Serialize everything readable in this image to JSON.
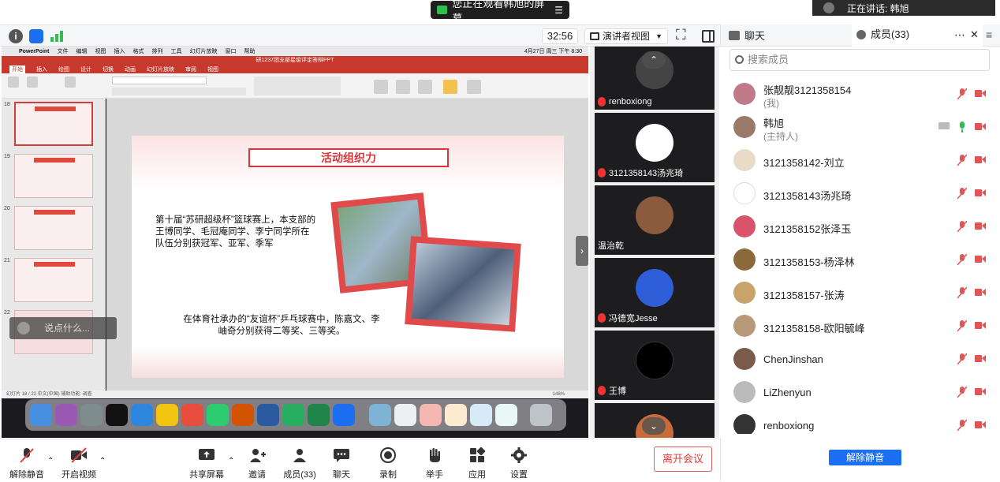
{
  "banner": {
    "watching": "您正在观看韩旭的屏幕",
    "menu_icon": "list-icon",
    "speaking": "正在讲话: 韩旭"
  },
  "toolbar": {
    "timer": "32:56",
    "view_mode": "演讲者视图",
    "view_caret": "▼",
    "fullscreen_glyph": "⛶"
  },
  "panel": {
    "chat_tab": "聊天",
    "members_tab": "成员(33)",
    "more": "⋯",
    "close": "✕",
    "menu": "≡",
    "search_placeholder": "搜索成员",
    "unmute_all": "解除静音"
  },
  "members": [
    {
      "name": "张靓靓3121358154",
      "role": "(我)",
      "avatar_color": "#c07a8a"
    },
    {
      "name": "韩旭",
      "role": "(主持人)",
      "avatar_color": "#9a7a6a",
      "mic_on": true
    },
    {
      "name": "3121358142-刘立",
      "role": "",
      "avatar_color": "#e8dcc8"
    },
    {
      "name": "3121358143汤兆琦",
      "role": "",
      "avatar_color": "#222222"
    },
    {
      "name": "3121358152张泽玉",
      "role": "",
      "avatar_color": "#d9536b"
    },
    {
      "name": "3121358153-杨泽林",
      "role": "",
      "avatar_color": "#8a6a3a"
    },
    {
      "name": "3121358157-张涛",
      "role": "",
      "avatar_color": "#c9a46a"
    },
    {
      "name": "3121358158-欧阳毓峰",
      "role": "",
      "avatar_color": "#b89a7a"
    },
    {
      "name": "ChenJinshan",
      "role": "",
      "avatar_color": "#7a5a4a"
    },
    {
      "name": "LiZhenyun",
      "role": "",
      "avatar_color": "#bbbbbb"
    },
    {
      "name": "renboxiong",
      "role": "",
      "avatar_color": "#333333"
    }
  ],
  "video_tiles": [
    {
      "name": "renboxiong",
      "avatar_color": "#444444"
    },
    {
      "name": "3121358143汤兆琦",
      "avatar_color": "#ffffff"
    },
    {
      "name": "温治乾",
      "avatar_color": "#8c5a3c"
    },
    {
      "name": "冯德宽Jesse",
      "avatar_color": "#2f5fd8"
    },
    {
      "name": "王博",
      "avatar_color": "#000000"
    },
    {
      "name": "",
      "avatar_color": "#c86a3a"
    }
  ],
  "scroll": {
    "up": "⌃",
    "down": "⌄",
    "collapse": "›"
  },
  "shared_screen": {
    "mac_menu": [
      "PowerPoint",
      "文件",
      "编辑",
      "视图",
      "插入",
      "格式",
      "排列",
      "工具",
      "幻灯片放映",
      "窗口",
      "帮助"
    ],
    "mac_clock": "4月27日 周三 下午 8:30",
    "doc_title": "研1237团支部星级评定答辩PPT",
    "ribbon_tabs": [
      "开始",
      "插入",
      "绘图",
      "设计",
      "切换",
      "动画",
      "幻灯片放映",
      "审阅",
      "视图"
    ],
    "slide_numbers": [
      "18",
      "19",
      "20",
      "21",
      "22"
    ],
    "slide_title": "活动组织力",
    "para1": "第十届“苏研超级杯”篮球赛上，本支部的王博同学、毛冠庵同学、李宁同学所在队伍分别获冠军、亚军、季军",
    "para2": "在体育社承办的“友谊杯”乒乓球赛中，陈嘉文、李岫奇分别获得二等奖、三等奖。",
    "status": "幻灯片 18 / 22    中文(中国)    辅助功能: 调查",
    "zoom": "148%",
    "chat_float": "说点什么..."
  },
  "bottom_bar": {
    "unmute": "解除静音",
    "start_video": "开启视频",
    "share": "共享屏幕",
    "invite": "邀请",
    "members": "成员(33)",
    "chat": "聊天",
    "record": "录制",
    "raise_hand": "举手",
    "apps": "应用",
    "settings": "设置",
    "leave": "离开会议"
  },
  "colors": {
    "accent_blue": "#1d6ff2",
    "leave_red": "#e33a3a",
    "ppt_red": "#c7392d",
    "muted_red": "#e05555"
  }
}
